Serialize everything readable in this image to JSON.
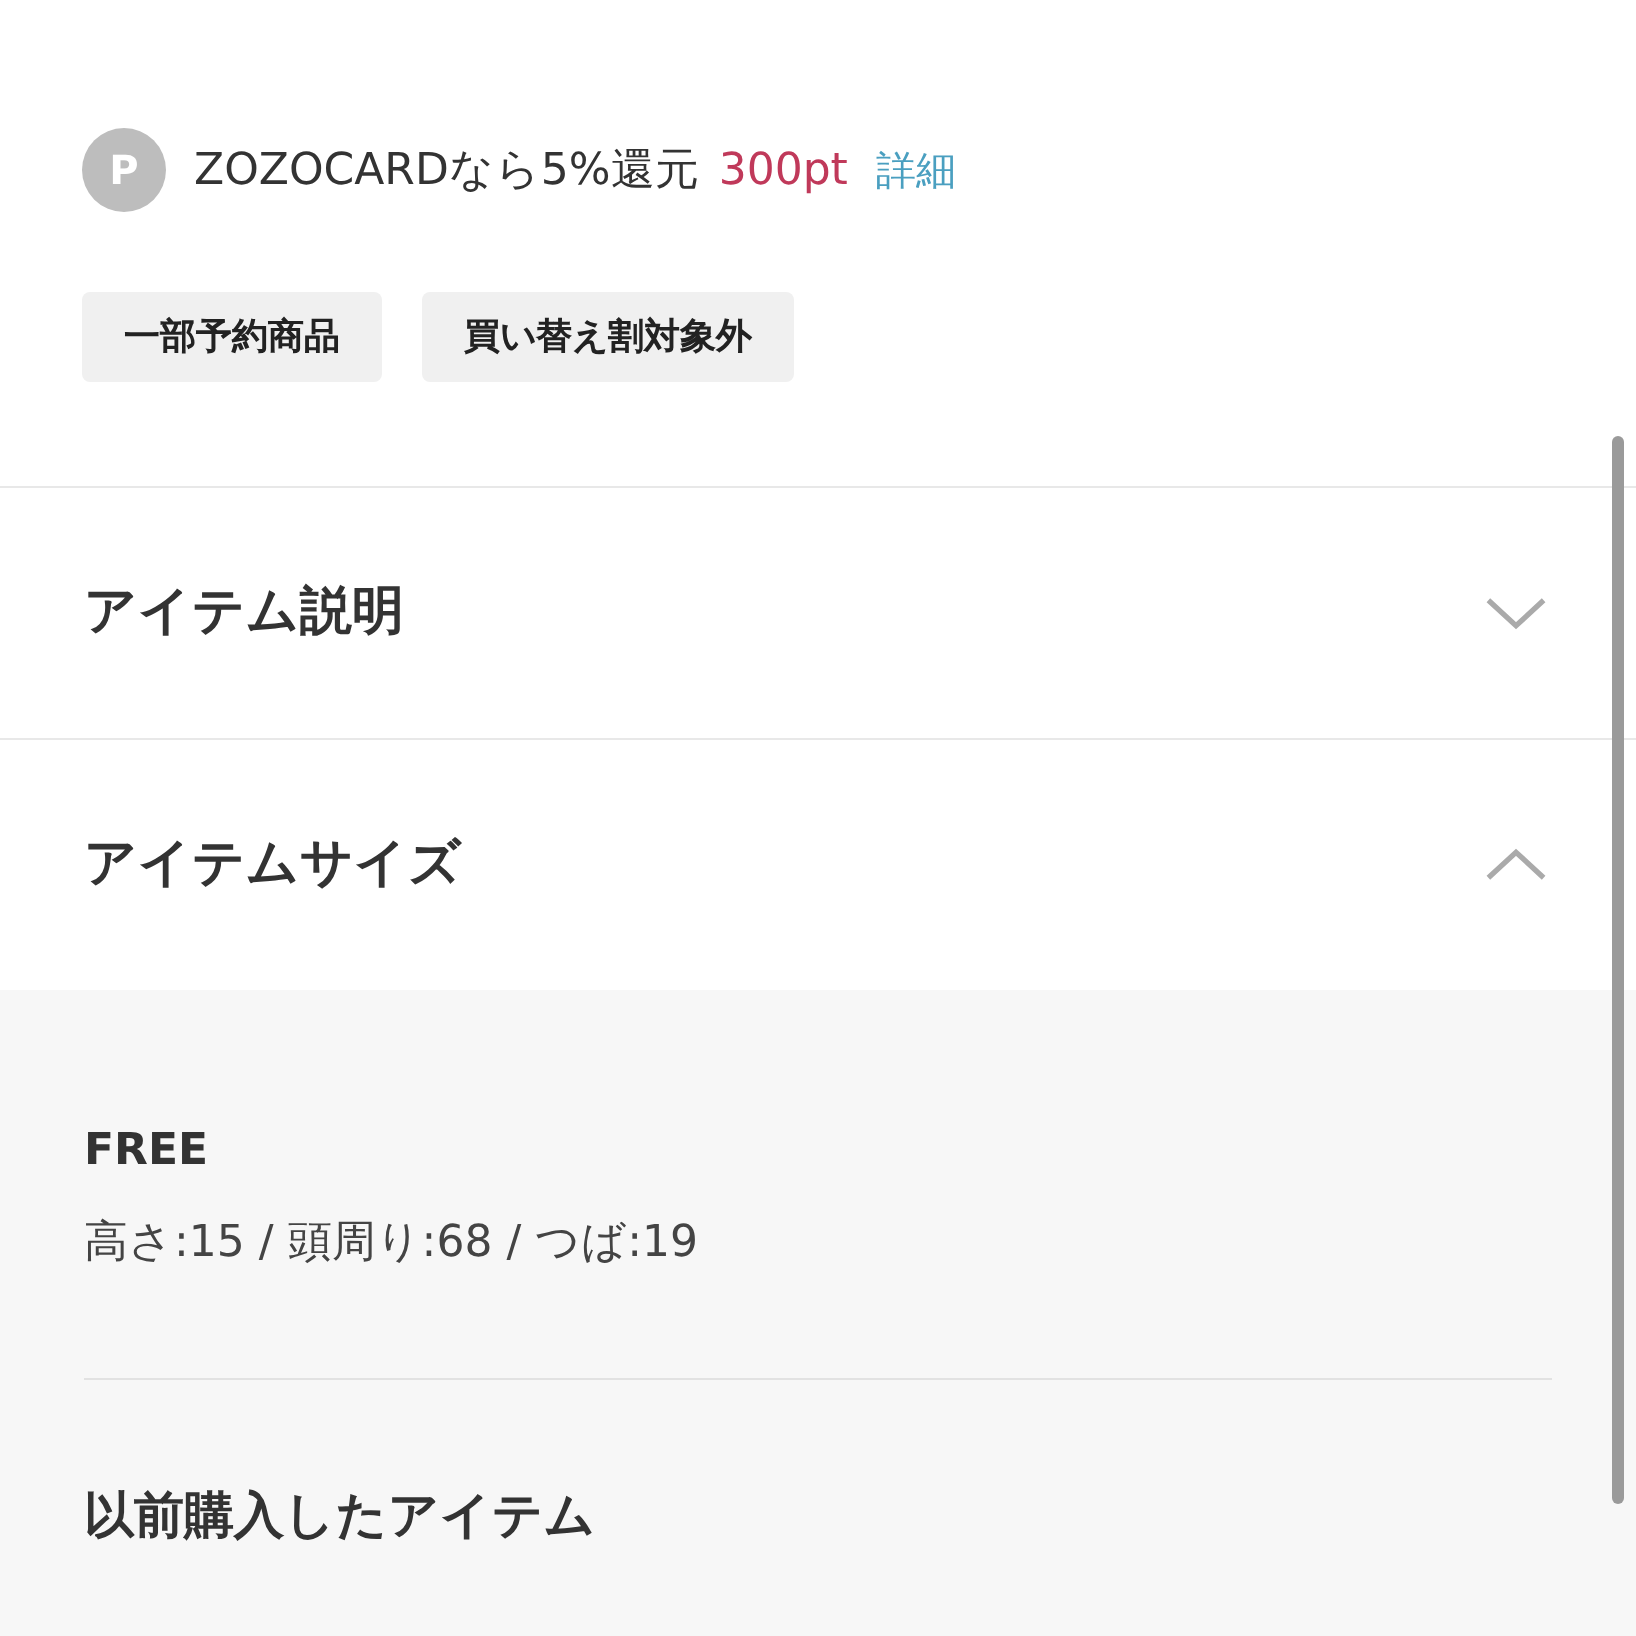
{
  "points": {
    "badge": "P",
    "text": "ZOZOCARDなら5%還元",
    "amount": "300pt",
    "link": "詳細"
  },
  "tags": [
    "一部予約商品",
    "買い替え割対象外"
  ],
  "accordion": [
    {
      "title": "アイテム説明",
      "expanded": false
    },
    {
      "title": "アイテムサイズ",
      "expanded": true
    }
  ],
  "sizes": [
    {
      "name": "FREE",
      "detail": "高さ:15 / 頭周り:68 / つば:19"
    }
  ],
  "history": {
    "title": "以前購入したアイテム"
  }
}
